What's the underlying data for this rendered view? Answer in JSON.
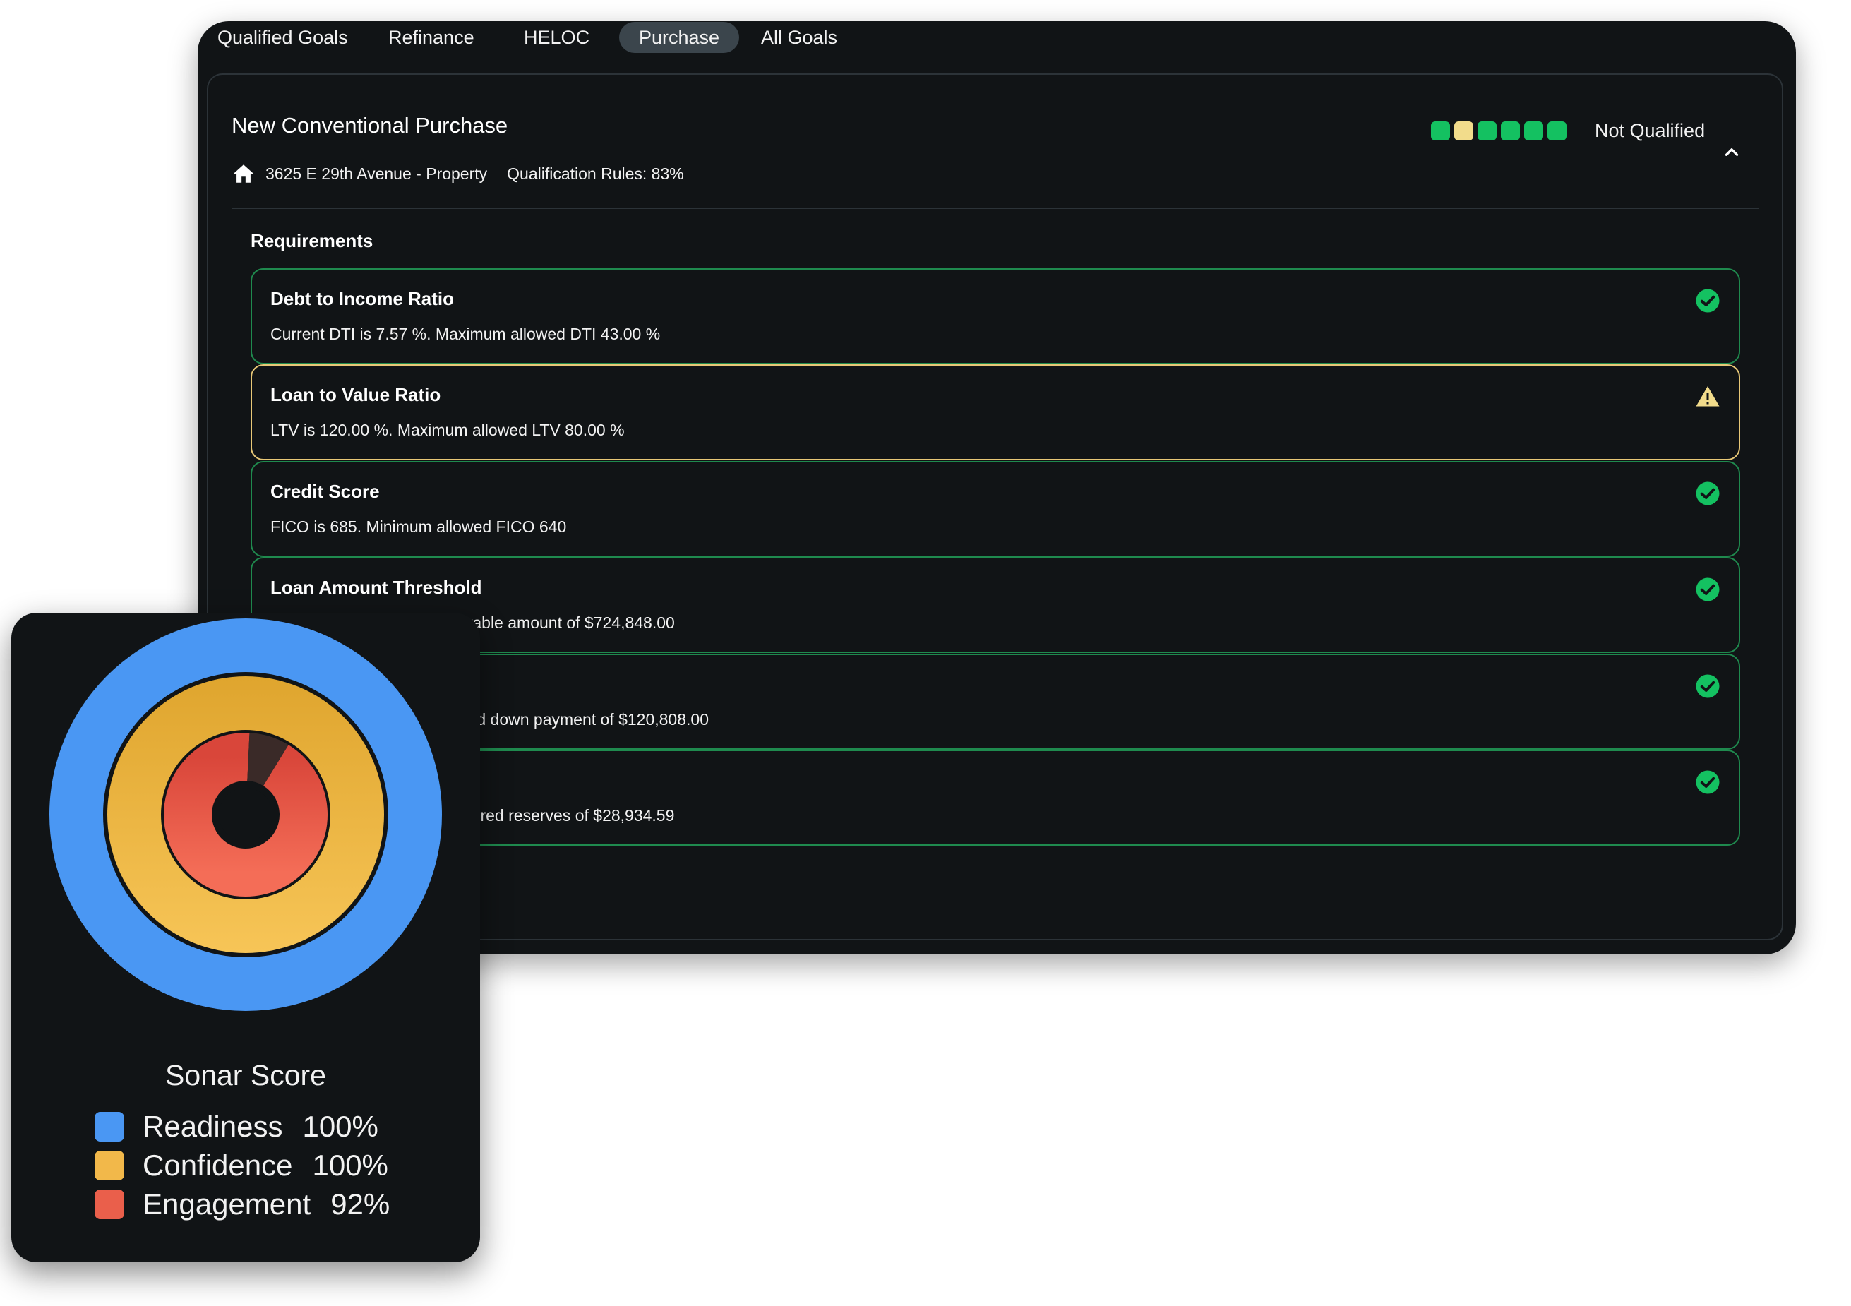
{
  "tabs": [
    {
      "label": "Qualified Goals",
      "active": false
    },
    {
      "label": "Refinance",
      "active": false
    },
    {
      "label": "HELOC",
      "active": false
    },
    {
      "label": "Purchase",
      "active": true
    },
    {
      "label": "All Goals",
      "active": false
    }
  ],
  "goal": {
    "title": "New Conventional Purchase",
    "property": "3625 E 29th Avenue - Property",
    "rules": "Qualification Rules: 83%",
    "status_label": "Not Qualified",
    "status_dots": [
      "#14c161",
      "#f2dc8b",
      "#14c161",
      "#14c161",
      "#14c161",
      "#14c161"
    ],
    "collapse_icon": "chevron-up-icon"
  },
  "requirements": {
    "heading": "Requirements",
    "items": [
      {
        "title": "Debt to Income Ratio",
        "desc": "Current DTI is 7.57 %. Maximum allowed DTI 43.00 %",
        "status": "pass"
      },
      {
        "title": "Loan to Value Ratio",
        "desc": "LTV is 120.00 %. Maximum allowed LTV 80.00 %",
        "status": "warn"
      },
      {
        "title": "Credit Score",
        "desc": "FICO is 685. Minimum allowed FICO 640",
        "status": "pass"
      },
      {
        "title": "Loan Amount Threshold",
        "desc": "724,848.00. Maximum allowable amount of $724,848.00",
        "status": "pass"
      },
      {
        "title": "",
        "desc": "5.00 are sufficient for required down payment of $120,808.00",
        "status": "pass"
      },
      {
        "title": "",
        "desc": "597.00 are sufficient for required reserves of $28,934.59",
        "status": "pass"
      }
    ]
  },
  "sonar": {
    "title": "Sonar Score",
    "metrics": [
      {
        "name": "Readiness",
        "value": "100%",
        "color": "#4a97f3"
      },
      {
        "name": "Confidence",
        "value": "100%",
        "color": "#f2b84a"
      },
      {
        "name": "Engagement",
        "value": "92%",
        "color": "#ea5f4b"
      }
    ]
  },
  "colors": {
    "pass": "#14c161",
    "warn": "#f2dc8b",
    "panel": "#111416"
  }
}
